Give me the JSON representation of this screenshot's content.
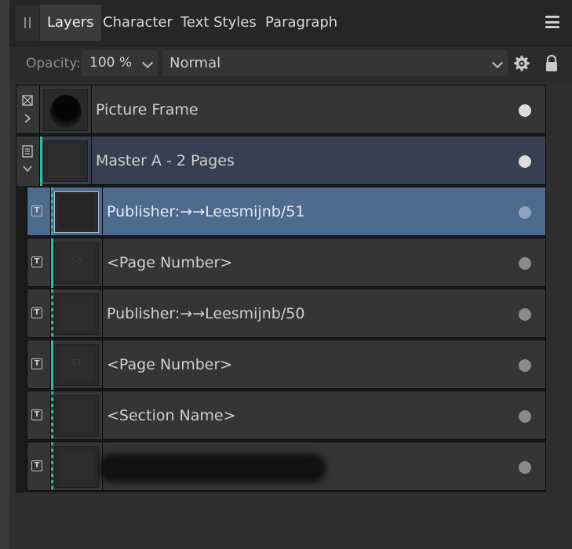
{
  "tabs": [
    "Layers",
    "Character",
    "Text Styles",
    "Paragraph"
  ],
  "toolbar": {
    "opacity_label": "Opacity:",
    "opacity_value": "100 %",
    "blend_mode": "Normal",
    "icons": [
      "settings-gear-icon",
      "lock-icon"
    ]
  },
  "layers": [
    {
      "name": "Picture Frame",
      "type": "picture-frame",
      "expanded": false
    },
    {
      "name": "Master A - 2 Pages",
      "type": "master",
      "expanded": true
    },
    {
      "name": "Publisher:→→Leesmijnb/51",
      "type": "text",
      "selected": true
    },
    {
      "name": "<Page Number>",
      "type": "text",
      "thumb_text": "50"
    },
    {
      "name": "Publisher:→→Leesmijnb/50",
      "type": "text"
    },
    {
      "name": "<Page Number>",
      "type": "text",
      "thumb_text": "51"
    },
    {
      "name": "<Section Name>",
      "type": "text"
    },
    {
      "name": "",
      "type": "text",
      "redacted": true
    }
  ],
  "colors": {
    "accent_teal": "#33b8a3",
    "selection": "#4d6a8f",
    "master_bg": "#374050"
  }
}
